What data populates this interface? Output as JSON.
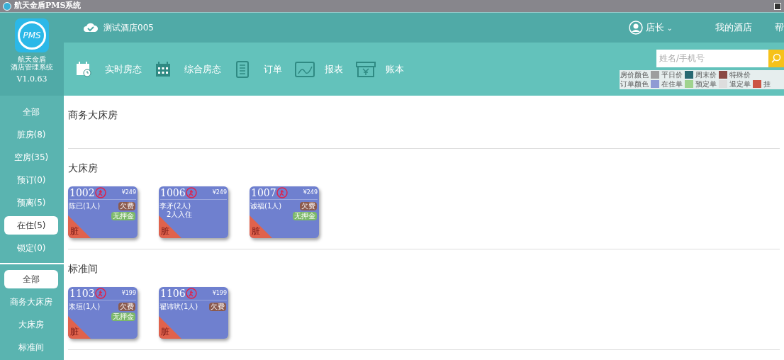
{
  "window": {
    "title": "航天金盾PMS系统"
  },
  "logo": {
    "lines": [
      "航天金盾",
      "酒店管理系统"
    ],
    "version": "V1.0.63",
    "mark": "PMS"
  },
  "hotel": {
    "name": "测试酒店005"
  },
  "user": {
    "name": "店长",
    "caret": "⌄"
  },
  "top_links": [
    "我的酒店",
    "帮"
  ],
  "nav": [
    {
      "kind": "calendar-clock",
      "label": "实时房态"
    },
    {
      "kind": "calendar-grid",
      "label": "综合房态"
    },
    {
      "kind": "list",
      "label": "订单"
    },
    {
      "kind": "chart",
      "label": "报表"
    },
    {
      "kind": "box",
      "label": "账本"
    }
  ],
  "search": {
    "placeholder": "姓名/手机号"
  },
  "legend": [
    {
      "label": "房价颜色",
      "items": [
        {
          "name": "平日价",
          "color": "#9e9e9e"
        },
        {
          "name": "周末价",
          "color": "#276872"
        },
        {
          "name": "特殊价",
          "color": "#8b4a45"
        }
      ]
    },
    {
      "label": "订单颜色",
      "items": [
        {
          "name": "在住单",
          "color": "#8f9bd4"
        },
        {
          "name": "预定单",
          "color": "#9fd38e"
        },
        {
          "name": "退定单",
          "color": "#dddddd"
        },
        {
          "name": "挂",
          "color": "#cc5544"
        }
      ]
    }
  ],
  "status_filters": [
    {
      "label": "全部",
      "selected": false
    },
    {
      "label": "脏房(8)",
      "selected": false
    },
    {
      "label": "空房(35)",
      "selected": false
    },
    {
      "label": "预订(0)",
      "selected": false
    },
    {
      "label": "预离(5)",
      "selected": false
    },
    {
      "label": "在住(5)",
      "selected": true
    },
    {
      "label": "锁定(0)",
      "selected": false
    }
  ],
  "type_filters": [
    {
      "label": "全部",
      "selected": true
    },
    {
      "label": "商务大床房",
      "selected": false
    },
    {
      "label": "大床房",
      "selected": false
    },
    {
      "label": "标准间",
      "selected": false
    }
  ],
  "sections": [
    {
      "title": "商务大床房"
    },
    {
      "title": "大床房",
      "rooms": [
        {
          "number": "1002",
          "price": "¥249",
          "guest": "陈已(1人)",
          "corner": "脏",
          "badges": [
            {
              "label": "欠费",
              "color": "#8b5a4e"
            },
            {
              "label": "无押金",
              "color": "#7cb86a"
            }
          ]
        },
        {
          "number": "1006",
          "price": "¥249",
          "guest": "李矛(2人)",
          "note": "2人入住",
          "corner": "脏"
        },
        {
          "number": "1007",
          "price": "¥249",
          "guest": "诚福(1人)",
          "corner": "脏",
          "badges": [
            {
              "label": "欠费",
              "color": "#8b5a4e"
            },
            {
              "label": "无押金",
              "color": "#7cb86a"
            }
          ]
        }
      ]
    },
    {
      "title": "标准间",
      "rooms": [
        {
          "number": "1103",
          "price": "¥199",
          "guest": "浆垣(1人)",
          "corner": "脏",
          "badges": [
            {
              "label": "欠费",
              "color": "#8b5a4e"
            },
            {
              "label": "无押金",
              "color": "#7cb86a"
            }
          ]
        },
        {
          "number": "1106",
          "price": "¥199",
          "guest": "翟讳吠(1人)",
          "corner": "脏",
          "badges": [
            {
              "label": "欠费",
              "color": "#8b5a4e"
            }
          ]
        }
      ]
    }
  ]
}
